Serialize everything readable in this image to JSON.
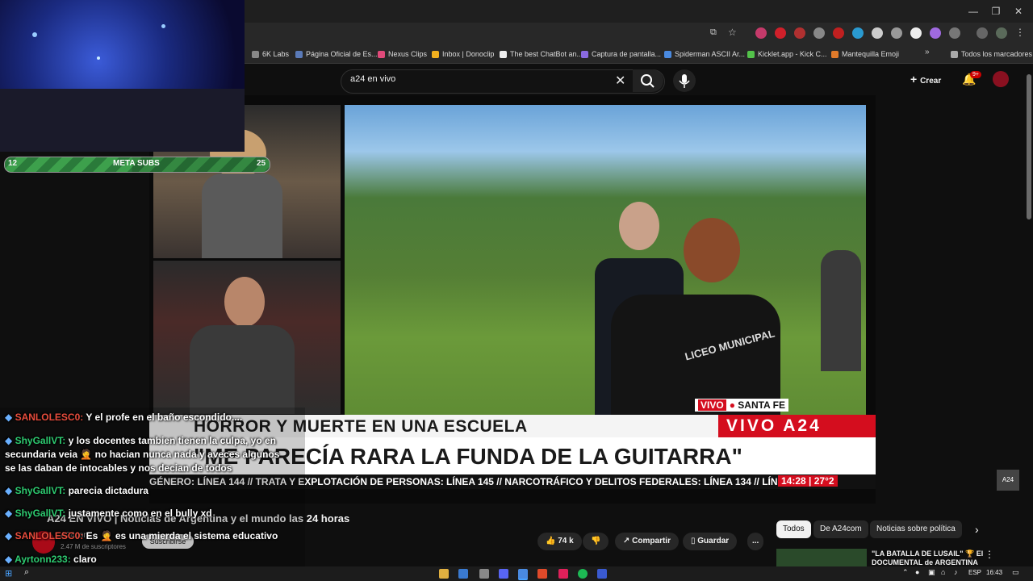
{
  "browser": {
    "address": "",
    "bookmarks": [
      {
        "label": "6K Labs",
        "color": "#888888"
      },
      {
        "label": "Página Oficial de Es...",
        "color": "#5a7ab8"
      },
      {
        "label": "Nexus Clips",
        "color": "#e04a7a"
      },
      {
        "label": "Inbox | Donoclip",
        "color": "#f2b01e"
      },
      {
        "label": "The best ChatBot an...",
        "color": "#eeeeee"
      },
      {
        "label": "Captura de pantalla...",
        "color": "#8a6ae0"
      },
      {
        "label": "Spiderman ASCII Ar...",
        "color": "#4a8ae0"
      },
      {
        "label": "Kicklet.app - Kick C...",
        "color": "#53c24a"
      },
      {
        "label": "Mantequilla Emoji",
        "color": "#e07a2a"
      }
    ],
    "all_bookmarks": "Todos los marcadores"
  },
  "youtube": {
    "search_value": "a24 en vivo",
    "create_label": "Crear",
    "notif_count": "9+",
    "video_title": "A24 EN VIVO | Noticias de Argentina y el mundo las 24 horas",
    "channel": "A24com",
    "subscribers": "2.47 M de suscriptores",
    "subscribe_label": "Suscribirse",
    "likes": "74 k",
    "share_label": "Compartir",
    "save_label": "Guardar",
    "more_label": "...",
    "rail_tags": [
      "Todos",
      "De A24com",
      "Noticias sobre política"
    ],
    "rail_video_title": "\"LA BATALLA DE LUSAIL\" 🏆 El DOCUMENTAL de ARGENTINA"
  },
  "broadcast": {
    "live_tag": "VIVO",
    "location": "SANTA FE",
    "headline_top": "HORROR Y MUERTE EN UNA ESCUELA",
    "headline_main": "\"ME PARECÍA RARA LA FUNDA DE LA GUITARRA\"",
    "brand": "VIVO A24",
    "ticker": "GÉNERO: LÍNEA 144 // TRATA Y EXPLOTACIÓN DE PERSONAS: LÍNEA 145 // NARCOTRÁFICO Y DELITOS FEDERALES: LÍNEA 134 // LÍNEA 141 ESC",
    "time_temp": "14:28 | 27°2",
    "shirt_text": "LICEO MUNICIPAL",
    "corner_logo": "A24"
  },
  "overlay": {
    "meta_label": "META SUBS",
    "meta_min": "12",
    "meta_max": "25",
    "meta_progress": 0.48
  },
  "chat": [
    {
      "user": "SANLOLESC0:",
      "message": "Y el profe en el baño escondido....",
      "color": "#e74c3c"
    },
    {
      "user": "ShyGallVT:",
      "message": "y los docentes tambien tienen la culpa, yo en",
      "color": "#2ecc71"
    },
    {
      "user": "",
      "message": "secundaria veia 🤦 no hacian nunca nada y aveces algunos",
      "color": "#ffffff"
    },
    {
      "user": "",
      "message": "se las daban de intocables y nos decian de todos",
      "color": "#ffffff"
    },
    {
      "user": "ShyGallVT:",
      "message": "parecia dictadura",
      "color": "#2ecc71"
    },
    {
      "user": "ShyGallVT:",
      "message": "justamente como en el bully xd",
      "color": "#2ecc71"
    },
    {
      "user": "SANLOLESC0:",
      "message": "Es 🤦 es una mierda el sistema educativo",
      "color": "#e74c3c"
    },
    {
      "user": "Ayrtonn233:",
      "message": "claro",
      "color": "#2ecc71"
    }
  ],
  "taskbar": {
    "lang": "ESP",
    "time": "16:43"
  },
  "colors": {
    "accent_red": "#d40d1e",
    "yt_bg": "#0f0f0f"
  }
}
